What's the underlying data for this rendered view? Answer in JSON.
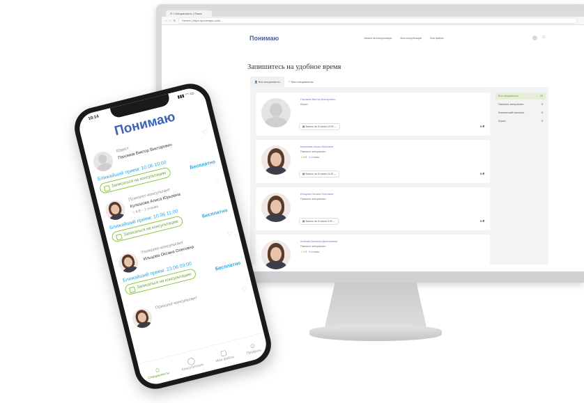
{
  "desktop": {
    "browser": {
      "tab_title": "Я / Специалисты | Поиск",
      "url": "Secure | https://ponimayu.com/..."
    },
    "header": {
      "logo": "Понимаю",
      "nav": [
        "Записи на консультации",
        "Мои консультации",
        "Мои файлы"
      ]
    },
    "page_title": "Запишитесь на удобное время",
    "tabs": [
      "Все специалисты",
      "Мои специалисты"
    ],
    "cards": [
      {
        "name": "Пахомов Виктор Викторович",
        "role": "Юрист",
        "rating": "",
        "slot": "Запись на 10 июня 10:00",
        "price": "0 ₽",
        "photo": false
      },
      {
        "name": "Кулешова Алиса Юрьевна",
        "role": "Психолог-консультант",
        "rating": "4.8 · 2 отзыва",
        "slot": "Запись на 10 июня 11:00",
        "price": "0 ₽",
        "photo": true
      },
      {
        "name": "Ильцова Оксана Олеговна",
        "role": "Психолог-консультант",
        "rating": "",
        "slot": "Запись на 10 июня 9:00",
        "price": "0 ₽",
        "photo": true
      },
      {
        "name": "Агапова Валерия Дмитриевна",
        "role": "Психолог-консультант",
        "rating": "4.9 · 3 отзыва",
        "slot": "",
        "price": "",
        "photo": true
      }
    ],
    "filters": [
      {
        "label": "Все специалисты",
        "count": "25"
      },
      {
        "label": "Психолог-консультант",
        "count": "6"
      },
      {
        "label": "Клинический психолог",
        "count": "6"
      },
      {
        "label": "Юрист",
        "count": "6"
      }
    ]
  },
  "phone": {
    "time": "10:14",
    "status_icons": "▮▮▮ ◠ ▭",
    "logo": "Понимаю",
    "cards": [
      {
        "role": "Юрист",
        "name": "Пахомов Виктор Викторович",
        "meta": "",
        "slot": "Ближайший прием: 10.06 10:00",
        "book": "Записаться на консультацию",
        "free": "Бесплатно",
        "photo": false
      },
      {
        "role": "Психолог-консультант",
        "name": "Кулешова Алиса Юрьевна",
        "meta": "☆ 4.8   ◌ 2 отзыва",
        "slot": "Ближайший прием: 10.06 11:00",
        "book": "Записаться на консультацию",
        "free": "Бесплатно",
        "photo": true
      },
      {
        "role": "Психолог-консультант",
        "name": "Ильцова Оксана Олеговна",
        "meta": "",
        "slot": "Ближайший прием: 23.06 09:00",
        "book": "Записаться на консультацию",
        "free": "Бесплатно",
        "photo": true
      },
      {
        "role": "Психолог-консультант",
        "name": "",
        "meta": "",
        "slot": "",
        "book": "",
        "free": "",
        "photo": true
      }
    ],
    "tabbar": [
      "Специалисты",
      "Консультации",
      "Мои файлы",
      "Профиль"
    ]
  },
  "colors": {
    "accent_blue": "#3b63b8",
    "link_blue": "#28a7e0",
    "green": "#8cc63f"
  }
}
